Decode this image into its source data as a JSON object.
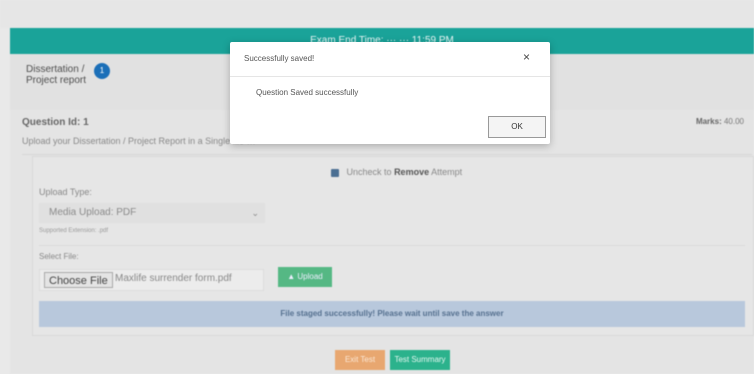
{
  "header": {
    "user_menu": "",
    "timer_text": "Exam End Time: ··· ··· 11:59 PM"
  },
  "section": {
    "title": "Dissertation / Project report",
    "badge": "1"
  },
  "question": {
    "id_label": "Question Id: 1",
    "marks_label": "Marks:",
    "marks_value": "40.00",
    "instruction": "Upload your Dissertation / Project Report in a Single file …"
  },
  "form": {
    "remove_prefix": "Uncheck to",
    "remove_bold": "Remove",
    "remove_suffix": "Attempt",
    "upload_type_label": "Upload Type:",
    "upload_type_value": "Media Upload: PDF",
    "supported_text": "Supported Extension: .pdf",
    "select_file_label": "Select File:",
    "choose_file_label": "Choose File",
    "file_name": "Maxlife surrender form.pdf",
    "upload_label": "Upload",
    "staged_message": "File staged successfully! Please wait until save the answer"
  },
  "footer": {
    "exit_label": "Exit Test",
    "summary_label": "Test Summary"
  },
  "modal": {
    "title": "Successfully saved!",
    "close_glyph": "×",
    "body": "Question Saved successfully",
    "ok_label": "OK"
  },
  "colors": {
    "teal": "#1aa399",
    "badge_blue": "#1b6fb8",
    "upload_green": "#55b884",
    "exit_orange": "#e8a770",
    "summary_green": "#2bb28c"
  }
}
